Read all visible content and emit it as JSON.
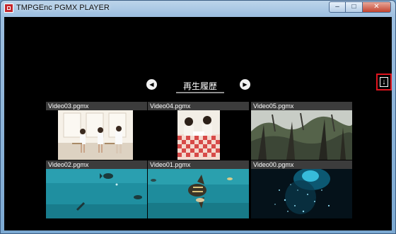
{
  "window": {
    "title": "TMPGEnc PGMX PLAYER",
    "buttons": {
      "minimize": "–",
      "maximize": "□",
      "close": "✕"
    }
  },
  "history": {
    "title": "再生履歴",
    "prev_icon": "◀",
    "next_icon": "▶"
  },
  "download_button": {
    "icon": "↓"
  },
  "videos": [
    {
      "name": "Video03.pgmx"
    },
    {
      "name": "Video04.pgmx"
    },
    {
      "name": "Video05.pgmx"
    },
    {
      "name": "Video02.pgmx"
    },
    {
      "name": "Video01.pgmx"
    },
    {
      "name": "Video00.pgmx"
    }
  ],
  "colors": {
    "accent_highlight": "#e0141e",
    "content_bg": "#000000"
  }
}
